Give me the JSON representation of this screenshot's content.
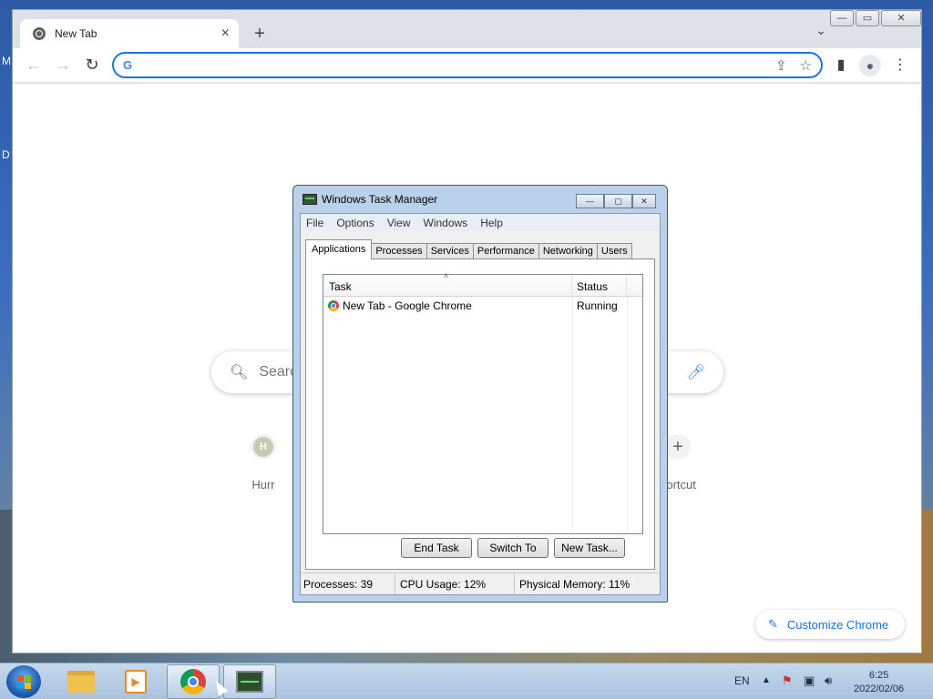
{
  "desktop": {
    "edge_label_1": "M",
    "edge_label_2": "D"
  },
  "chrome": {
    "tab": {
      "title": "New Tab",
      "close": "×"
    },
    "new_tab": "+",
    "tab_search": "⌄",
    "window_buttons": {
      "minimize": "—",
      "maximize": "▭",
      "close": "✕"
    },
    "nav": {
      "back": "←",
      "forward": "→",
      "reload": "↻"
    },
    "omnibox": {
      "value": "",
      "g_logo": "G"
    },
    "toolbar_icons": {
      "share": "⇪",
      "bookmark": "☆",
      "side_panel": "▮",
      "profile": "●",
      "menu": "⋮"
    },
    "new_tab_page": {
      "search_placeholder": "Searc",
      "shortcuts": [
        {
          "letter": "H",
          "label": "Hurr"
        },
        {
          "letter": "+",
          "label": "hortcut"
        }
      ],
      "customize_label": "Customize Chrome",
      "customize_icon": "✎"
    }
  },
  "task_manager": {
    "title": "Windows Task Manager",
    "caption_buttons": {
      "minimize": "—",
      "maximize": "▢",
      "close": "✕"
    },
    "menu": [
      "File",
      "Options",
      "View",
      "Windows",
      "Help"
    ],
    "tabs": [
      "Applications",
      "Processes",
      "Services",
      "Performance",
      "Networking",
      "Users"
    ],
    "active_tab": "Applications",
    "columns": {
      "task": "Task",
      "status": "Status",
      "sort_indicator": "˄"
    },
    "rows": [
      {
        "task": "New Tab - Google Chrome",
        "status": "Running"
      }
    ],
    "buttons": {
      "end_task": "End Task",
      "switch_to": "Switch To",
      "new_task": "New Task..."
    },
    "status_bar": {
      "processes": "Processes: 39",
      "cpu": "CPU Usage: 12%",
      "memory": "Physical Memory: 11%"
    }
  },
  "taskbar": {
    "tray": {
      "language": "EN",
      "show_hidden": "▲"
    },
    "clock": {
      "time": "6:25",
      "date": "2022/02/06"
    }
  }
}
